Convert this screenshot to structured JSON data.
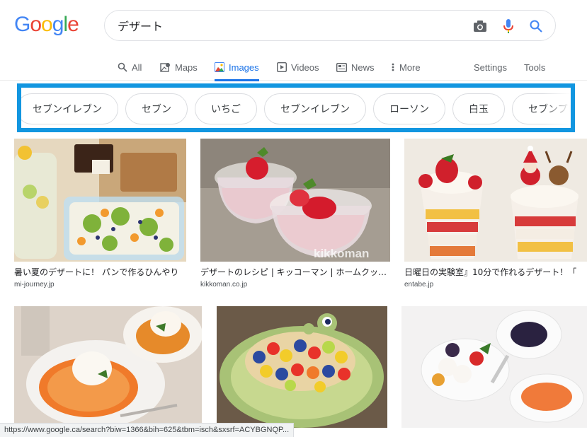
{
  "logo": {
    "letters": [
      "G",
      "o",
      "o",
      "g",
      "l",
      "e"
    ],
    "colors": [
      "#4285f4",
      "#ea4335",
      "#fbbc05",
      "#4285f4",
      "#34a853",
      "#ea4335"
    ]
  },
  "search": {
    "query": "デザート"
  },
  "tabs": [
    {
      "label": "All",
      "icon": "search-icon"
    },
    {
      "label": "Maps",
      "icon": "map-icon"
    },
    {
      "label": "Images",
      "icon": "image-icon",
      "active": true
    },
    {
      "label": "Videos",
      "icon": "play-icon"
    },
    {
      "label": "News",
      "icon": "news-icon"
    },
    {
      "label": "More",
      "icon": "more-vert-icon"
    }
  ],
  "tools": {
    "settings": "Settings",
    "tools": "Tools"
  },
  "chips": [
    "セブンイレブン",
    "セブン",
    "いちご",
    "セブンイレブン",
    "ローソン",
    "白玉",
    "セブンプレミアム"
  ],
  "results": [
    {
      "title": "暑い夏のデザートに！ パンで作るひんやり",
      "domain": "mi-journey.jp"
    },
    {
      "title": "デザートのレシピ | キッコーマン | ホームクッキング",
      "domain": "kikkoman.co.jp",
      "watermark": "kikkoman"
    },
    {
      "title": "日曜日の実験室』10分で作れるデザート！「",
      "domain": "entabe.jp"
    },
    {
      "title": "",
      "domain": ""
    },
    {
      "title": "",
      "domain": ""
    },
    {
      "title": "",
      "domain": ""
    }
  ],
  "status_url": "https://www.google.ca/search?biw=1366&bih=625&tbm=isch&sxsrf=ACYBGNQP...",
  "colors": {
    "accent": "#1a73e8",
    "highlight": "#1296e0"
  }
}
